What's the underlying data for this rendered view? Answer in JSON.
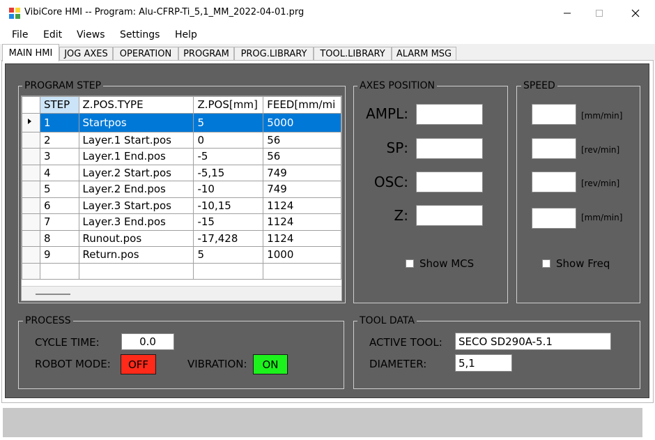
{
  "window": {
    "title": "VibiCore HMI -- Program: Alu-CFRP-Ti_5,1_MM_2022-04-01.prg",
    "minimize_icon": "minimize-icon",
    "maximize_icon": "maximize-icon",
    "close_icon": "close-icon"
  },
  "menu": [
    "File",
    "Edit",
    "Views",
    "Settings",
    "Help"
  ],
  "tabs": [
    "MAIN HMI",
    "JOG AXES",
    "OPERATION",
    "PROGRAM",
    "PROG.LIBRARY",
    "TOOL.LIBRARY",
    "ALARM MSG"
  ],
  "active_tab": "MAIN HMI",
  "program_step": {
    "title": "PROGRAM STEP",
    "columns": [
      "STEP",
      "Z.POS.TYPE",
      "Z.POS[mm]",
      "FEED[mm/mi"
    ],
    "rows": [
      [
        "1",
        "Startpos",
        "5",
        "5000"
      ],
      [
        "2",
        "Layer.1 Start.pos",
        "0",
        "56"
      ],
      [
        "3",
        "Layer.1 End.pos",
        "-5",
        "56"
      ],
      [
        "4",
        "Layer.2 Start.pos",
        "-5,15",
        "749"
      ],
      [
        "5",
        "Layer.2 End.pos",
        "-10",
        "749"
      ],
      [
        "6",
        "Layer.3 Start.pos",
        "-10,15",
        "1124"
      ],
      [
        "7",
        "Layer.3 End.pos",
        "-15",
        "1124"
      ],
      [
        "8",
        "Runout.pos",
        "-17,428",
        "1124"
      ],
      [
        "9",
        "Return.pos",
        "5",
        "1000"
      ]
    ],
    "selected_row": 1
  },
  "axes_position": {
    "title": "AXES POSITION",
    "labels": [
      "AMPL:",
      "SP:",
      "OSC:",
      "Z:"
    ],
    "show_mcs_label": "Show MCS",
    "show_mcs_checked": false
  },
  "speed": {
    "title": "SPEED",
    "units": [
      "[mm/min]",
      "[rev/min]",
      "[rev/min]",
      "[mm/min]"
    ],
    "show_freq_label": "Show Freq",
    "show_freq_checked": false
  },
  "process": {
    "title": "PROCESS",
    "cycle_time_label": "CYCLE TIME:",
    "cycle_time_value": "0.0",
    "robot_mode_label": "ROBOT MODE:",
    "robot_mode_value": "OFF",
    "vibration_label": "VIBRATION:",
    "vibration_value": "ON"
  },
  "tool_data": {
    "title": "TOOL DATA",
    "active_tool_label": "ACTIVE TOOL:",
    "active_tool_value": "SECO SD290A-5.1",
    "diameter_label": "DIAMETER:",
    "diameter_value": "5,1"
  },
  "colors": {
    "panel_bg": "#606060",
    "selection": "#0078d7",
    "header_selected": "#cce4f7",
    "off_red": "#ff2a1a",
    "on_green": "#1cf21c"
  }
}
